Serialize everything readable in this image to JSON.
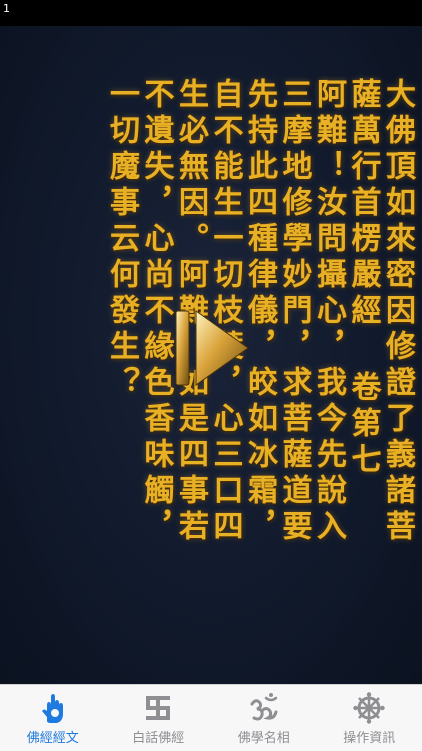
{
  "status": {
    "number": "1"
  },
  "sutra": {
    "columns": [
      "大佛頂如來密因修證了義諸菩",
      "薩萬行首楞嚴經 卷第七",
      "阿難！汝問攝心，我今先說入",
      "三摩地修學妙門，求菩薩道要",
      "先持此四種律儀，皎如冰霜，",
      "自不能生一切枝葉，心三口四",
      "生必無因。阿難！如是四事若",
      "不遺失，心尚不緣色香味觸，",
      "一切魔事云何發生？"
    ]
  },
  "player": {
    "icon": "play-icon"
  },
  "tabs": [
    {
      "label": "佛經經文",
      "icon": "hand-icon",
      "active": true
    },
    {
      "label": "白話佛經",
      "icon": "swastika-icon",
      "active": false
    },
    {
      "label": "佛學名相",
      "icon": "om-icon",
      "active": false
    },
    {
      "label": "操作資訊",
      "icon": "dharma-wheel-icon",
      "active": false
    }
  ],
  "colors": {
    "text_gold": "#e8b025",
    "background": "#111a2c",
    "tab_active": "#1f7ae0",
    "tab_inactive": "#8e8e93"
  }
}
